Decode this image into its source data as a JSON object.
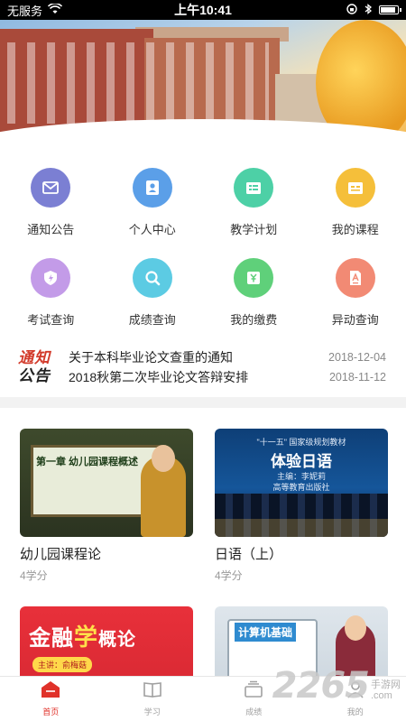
{
  "status_bar": {
    "carrier": "无服务",
    "time": "上午10:41"
  },
  "grid": [
    {
      "label": "通知公告",
      "icon": "mail-icon",
      "color": "#7b7fd3"
    },
    {
      "label": "个人中心",
      "icon": "user-icon",
      "color": "#5b9fe8"
    },
    {
      "label": "教学计划",
      "icon": "plan-icon",
      "color": "#4dd0a6"
    },
    {
      "label": "我的课程",
      "icon": "course-icon",
      "color": "#f5bf3a"
    },
    {
      "label": "考试查询",
      "icon": "exam-icon",
      "color": "#c39be8"
    },
    {
      "label": "成绩查询",
      "icon": "search-icon",
      "color": "#5ccbe3"
    },
    {
      "label": "我的缴费",
      "icon": "payment-icon",
      "color": "#5fd07a"
    },
    {
      "label": "异动查询",
      "icon": "change-icon",
      "color": "#f28a74"
    }
  ],
  "notices": {
    "logo_line1": "通知",
    "logo_line2": "公告",
    "items": [
      {
        "title": "关于本科毕业论文查重的通知",
        "date": "2018-12-04"
      },
      {
        "title": "2018秋第二次毕业论文答辩安排",
        "date": "2018-11-12"
      }
    ]
  },
  "courses": [
    {
      "name": "幼儿园课程论",
      "credit": "4学分",
      "thumb_text": "第一章  幼儿园课程概述"
    },
    {
      "name": "日语（上）",
      "credit": "4学分",
      "thumb_top": "\"十一五\" 国家级规划教材",
      "thumb_title": "体验日语",
      "thumb_sub1": "主编：李妮莉",
      "thumb_sub2": "高等教育出版社"
    },
    {
      "thumb_title_a": "金融",
      "thumb_title_b": "学",
      "thumb_title_c": "概论",
      "thumb_sub": "主讲：俞梅菇"
    },
    {
      "thumb_title": "计算机基础"
    }
  ],
  "bottom_nav": [
    {
      "label": "首页",
      "icon": "home-icon",
      "active": true
    },
    {
      "label": "学习",
      "icon": "book-icon",
      "active": false
    },
    {
      "label": "成绩",
      "icon": "grade-icon",
      "active": false
    },
    {
      "label": "我的",
      "icon": "profile-icon",
      "active": false
    }
  ],
  "watermark": {
    "number": "2265",
    "text1": "手游网",
    "text2": ".com"
  },
  "colors": {
    "accent": "#e0322a",
    "nav_inactive": "#a0a0a0"
  }
}
